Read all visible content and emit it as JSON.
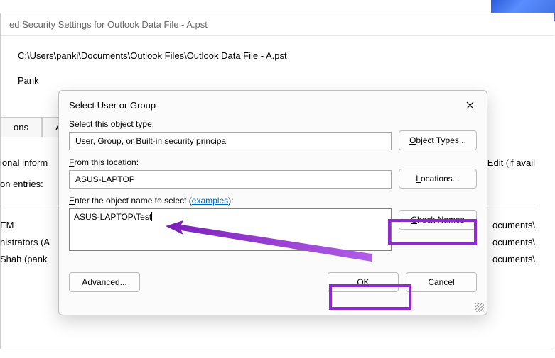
{
  "banner": {},
  "parent": {
    "title": "ed Security Settings for Outlook Data File - A.pst",
    "path": "C:\\Users\\panki\\Documents\\Outlook Files\\Outlook Data File - A.pst",
    "row_partial": "Pank",
    "tabs_partial": "ons",
    "info_line": "ional inform",
    "entries_line": "on entries:",
    "list_item1": "EM",
    "list_item2": "nistrators (A",
    "list_item3": " Shah (pank",
    "right_edit": "ck Edit (if avail",
    "right_path": "ocuments\\"
  },
  "dialog": {
    "title": "Select User or Group",
    "section1_label_pre": "S",
    "section1_label_post": "elect this object type:",
    "object_type_value": "User, Group, or Built-in security principal",
    "btn_object_types_pre": "O",
    "btn_object_types_post": "bject Types...",
    "section2_label_pre": "F",
    "section2_label_post": "rom this location:",
    "location_value": "ASUS-LAPTOP",
    "btn_locations_pre": "L",
    "btn_locations_post": "ocations...",
    "section3_label_pre": "E",
    "section3_label_post": "nter the object name to select (",
    "examples_link_pre": "e",
    "examples_link_post": "xamples",
    "section3_label_close": "):",
    "name_value": "ASUS-LAPTOP\\Test",
    "btn_check_pre": "C",
    "btn_check_post": "heck Names",
    "btn_advanced_pre": "A",
    "btn_advanced_post": "dvanced...",
    "btn_ok": "OK",
    "btn_cancel": "Cancel"
  }
}
